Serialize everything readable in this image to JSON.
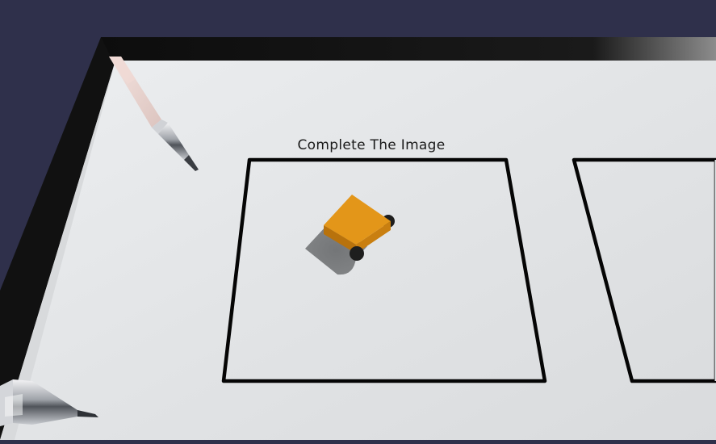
{
  "instruction": "Complete The Image",
  "colors": {
    "background": "#2f304b",
    "paper": "#e4e6e8",
    "frame": "#0d0d0d",
    "block_top": "#e2951a",
    "block_side": "#b8720c",
    "shadow": "#6e7072"
  },
  "scene_objects": {
    "pen_top": "pen",
    "pen_bottom": "pen",
    "drawing_block": "orange-block",
    "left_square": "drawing-area",
    "right_square": "drawing-area"
  }
}
